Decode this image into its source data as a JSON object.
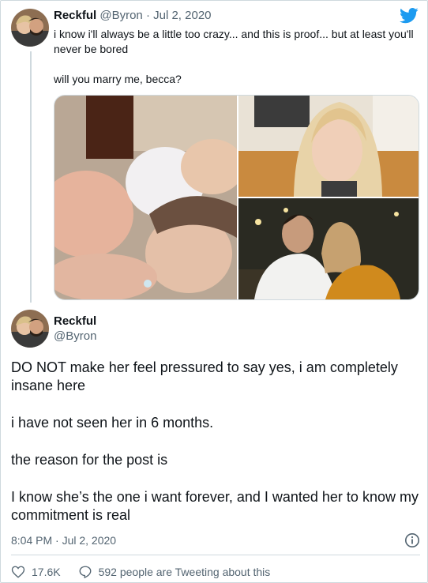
{
  "parent_tweet": {
    "display_name": "Reckful",
    "handle": "@Byron",
    "separator": "·",
    "date": "Jul 2, 2020",
    "text_1": "i know i'll always be a little too crazy... and this is proof... but at least you'll never be bored",
    "text_2": "will you marry me, becca?",
    "media": [
      "photo-couple-in-bed",
      "photo-woman-smiling",
      "photo-couple-at-restaurant"
    ]
  },
  "main_tweet": {
    "display_name": "Reckful",
    "handle": "@Byron",
    "paragraphs": [
      "DO NOT make her feel pressured to say yes, i am completely insane here",
      "i have not seen her in 6 months.",
      "the reason for the post is",
      "I know she’s the one i want forever, and I wanted her to know my commitment is real"
    ],
    "timestamp": "8:04 PM · Jul 2, 2020"
  },
  "actions": {
    "likes": "17.6K",
    "replies_text": "592 people are Tweeting about this"
  },
  "icons": {
    "logo": "twitter-bird-icon",
    "info": "info-icon",
    "like": "heart-icon",
    "reply": "comment-icon"
  },
  "colors": {
    "brand": "#1d9bf0",
    "text": "#0f1419",
    "muted": "#536471",
    "border": "#cfd9de"
  }
}
